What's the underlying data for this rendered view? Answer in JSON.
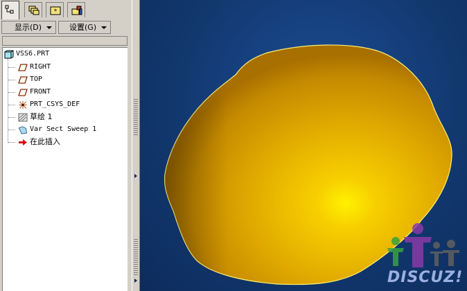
{
  "tabs": [
    {
      "name": "model-tree-tab",
      "icon": "model-tree-icon",
      "active": true
    },
    {
      "name": "layers-tab",
      "icon": "layers-icon",
      "active": false
    },
    {
      "name": "folder-tab",
      "icon": "folder-icon",
      "active": false
    },
    {
      "name": "favorites-tab",
      "icon": "favorites-icon",
      "active": false
    }
  ],
  "toolbar": {
    "show_label": "显示(D)",
    "settings_label": "设置(G)"
  },
  "tree": {
    "root": "VSS6.PRT",
    "items": [
      {
        "label": "RIGHT",
        "icon": "datum-plane-icon"
      },
      {
        "label": "TOP",
        "icon": "datum-plane-icon"
      },
      {
        "label": "FRONT",
        "icon": "datum-plane-icon"
      },
      {
        "label": "PRT_CSYS_DEF",
        "icon": "coordinate-system-icon"
      },
      {
        "label": "草绘 1",
        "icon": "sketch-icon"
      },
      {
        "label": "Var Sect Sweep 1",
        "icon": "sweep-feature-icon"
      },
      {
        "label": "在此插入",
        "icon": "insert-here-arrow-icon"
      }
    ]
  },
  "viewport": {
    "background_color": "#12386f",
    "model_color": "#f2c200"
  },
  "watermark": {
    "text": "DISCUZ!"
  }
}
